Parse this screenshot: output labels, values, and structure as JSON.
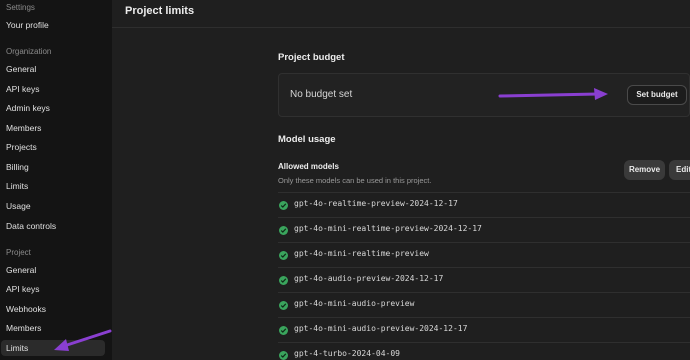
{
  "sidebar": {
    "settings_heading": "Settings",
    "profile": "Your profile",
    "organization_heading": "Organization",
    "org_items": [
      "General",
      "API keys",
      "Admin keys",
      "Members",
      "Projects",
      "Billing",
      "Limits",
      "Usage",
      "Data controls"
    ],
    "project_heading": "Project",
    "project_items": [
      "General",
      "API keys",
      "Webhooks",
      "Members",
      "Limits"
    ]
  },
  "page": {
    "title": "Project limits"
  },
  "budget": {
    "heading": "Project budget",
    "status": "No budget set",
    "set_button": "Set budget"
  },
  "model_usage": {
    "heading": "Model usage",
    "allowed_label": "Allowed models",
    "allowed_desc": "Only these models can be used in this project.",
    "remove_button": "Remove",
    "edit_button": "Edit",
    "models": [
      "gpt-4o-realtime-preview-2024-12-17",
      "gpt-4o-mini-realtime-preview-2024-12-17",
      "gpt-4o-mini-realtime-preview",
      "gpt-4o-audio-preview-2024-12-17",
      "gpt-4o-mini-audio-preview",
      "gpt-4o-mini-audio-preview-2024-12-17",
      "gpt-4-turbo-2024-04-09"
    ]
  },
  "colors": {
    "accent_arrow": "#8a3fd1",
    "check_green": "#3aa55d"
  }
}
